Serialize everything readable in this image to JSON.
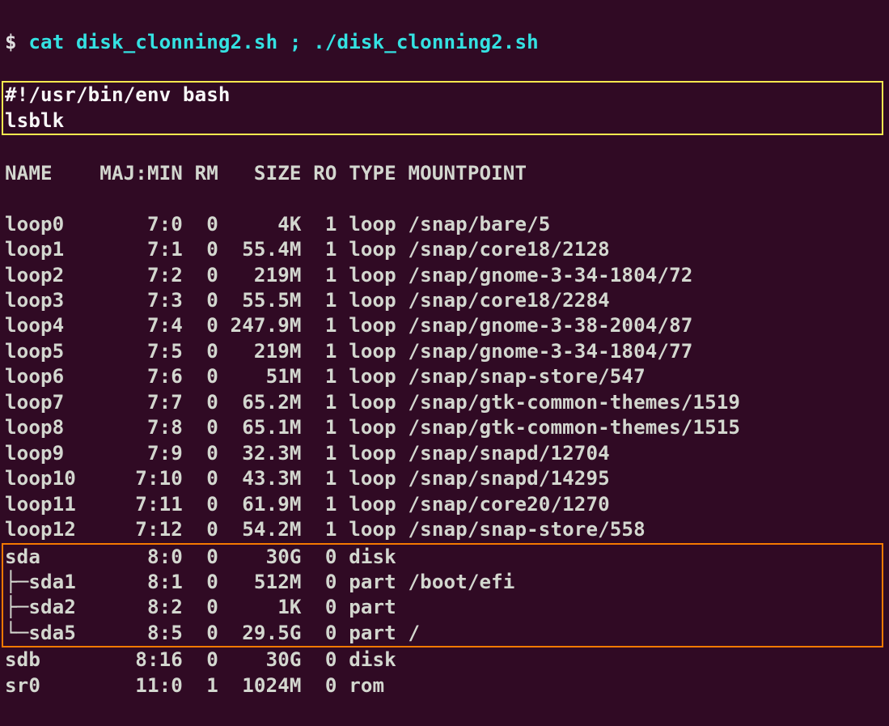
{
  "prompt_symbol": "$ ",
  "command": "cat disk_clonning2.sh ; ./disk_clonning2.sh",
  "script_lines": [
    "#!/usr/bin/env bash",
    "lsblk"
  ],
  "header": "NAME    MAJ:MIN RM   SIZE RO TYPE MOUNTPOINT",
  "rows": [
    {
      "name": "loop0",
      "majmin": "7:0",
      "rm": 0,
      "size": "4K",
      "ro": 1,
      "type": "loop",
      "mount": "/snap/bare/5"
    },
    {
      "name": "loop1",
      "majmin": "7:1",
      "rm": 0,
      "size": "55.4M",
      "ro": 1,
      "type": "loop",
      "mount": "/snap/core18/2128"
    },
    {
      "name": "loop2",
      "majmin": "7:2",
      "rm": 0,
      "size": "219M",
      "ro": 1,
      "type": "loop",
      "mount": "/snap/gnome-3-34-1804/72"
    },
    {
      "name": "loop3",
      "majmin": "7:3",
      "rm": 0,
      "size": "55.5M",
      "ro": 1,
      "type": "loop",
      "mount": "/snap/core18/2284"
    },
    {
      "name": "loop4",
      "majmin": "7:4",
      "rm": 0,
      "size": "247.9M",
      "ro": 1,
      "type": "loop",
      "mount": "/snap/gnome-3-38-2004/87"
    },
    {
      "name": "loop5",
      "majmin": "7:5",
      "rm": 0,
      "size": "219M",
      "ro": 1,
      "type": "loop",
      "mount": "/snap/gnome-3-34-1804/77"
    },
    {
      "name": "loop6",
      "majmin": "7:6",
      "rm": 0,
      "size": "51M",
      "ro": 1,
      "type": "loop",
      "mount": "/snap/snap-store/547"
    },
    {
      "name": "loop7",
      "majmin": "7:7",
      "rm": 0,
      "size": "65.2M",
      "ro": 1,
      "type": "loop",
      "mount": "/snap/gtk-common-themes/1519"
    },
    {
      "name": "loop8",
      "majmin": "7:8",
      "rm": 0,
      "size": "65.1M",
      "ro": 1,
      "type": "loop",
      "mount": "/snap/gtk-common-themes/1515"
    },
    {
      "name": "loop9",
      "majmin": "7:9",
      "rm": 0,
      "size": "32.3M",
      "ro": 1,
      "type": "loop",
      "mount": "/snap/snapd/12704"
    },
    {
      "name": "loop10",
      "majmin": "7:10",
      "rm": 0,
      "size": "43.3M",
      "ro": 1,
      "type": "loop",
      "mount": "/snap/snapd/14295"
    },
    {
      "name": "loop11",
      "majmin": "7:11",
      "rm": 0,
      "size": "61.9M",
      "ro": 1,
      "type": "loop",
      "mount": "/snap/core20/1270"
    },
    {
      "name": "loop12",
      "majmin": "7:12",
      "rm": 0,
      "size": "54.2M",
      "ro": 1,
      "type": "loop",
      "mount": "/snap/snap-store/558"
    },
    {
      "name": "sda",
      "majmin": "8:0",
      "rm": 0,
      "size": "30G",
      "ro": 0,
      "type": "disk",
      "mount": ""
    },
    {
      "name": "├─sda1",
      "majmin": "8:1",
      "rm": 0,
      "size": "512M",
      "ro": 0,
      "type": "part",
      "mount": "/boot/efi"
    },
    {
      "name": "├─sda2",
      "majmin": "8:2",
      "rm": 0,
      "size": "1K",
      "ro": 0,
      "type": "part",
      "mount": ""
    },
    {
      "name": "└─sda5",
      "majmin": "8:5",
      "rm": 0,
      "size": "29.5G",
      "ro": 0,
      "type": "part",
      "mount": "/"
    },
    {
      "name": "sdb",
      "majmin": "8:16",
      "rm": 0,
      "size": "30G",
      "ro": 0,
      "type": "disk",
      "mount": ""
    },
    {
      "name": "sr0",
      "majmin": "11:0",
      "rm": 1,
      "size": "1024M",
      "ro": 0,
      "type": "rom",
      "mount": ""
    }
  ],
  "highlight_orange_start": 13,
  "highlight_orange_end": 16
}
